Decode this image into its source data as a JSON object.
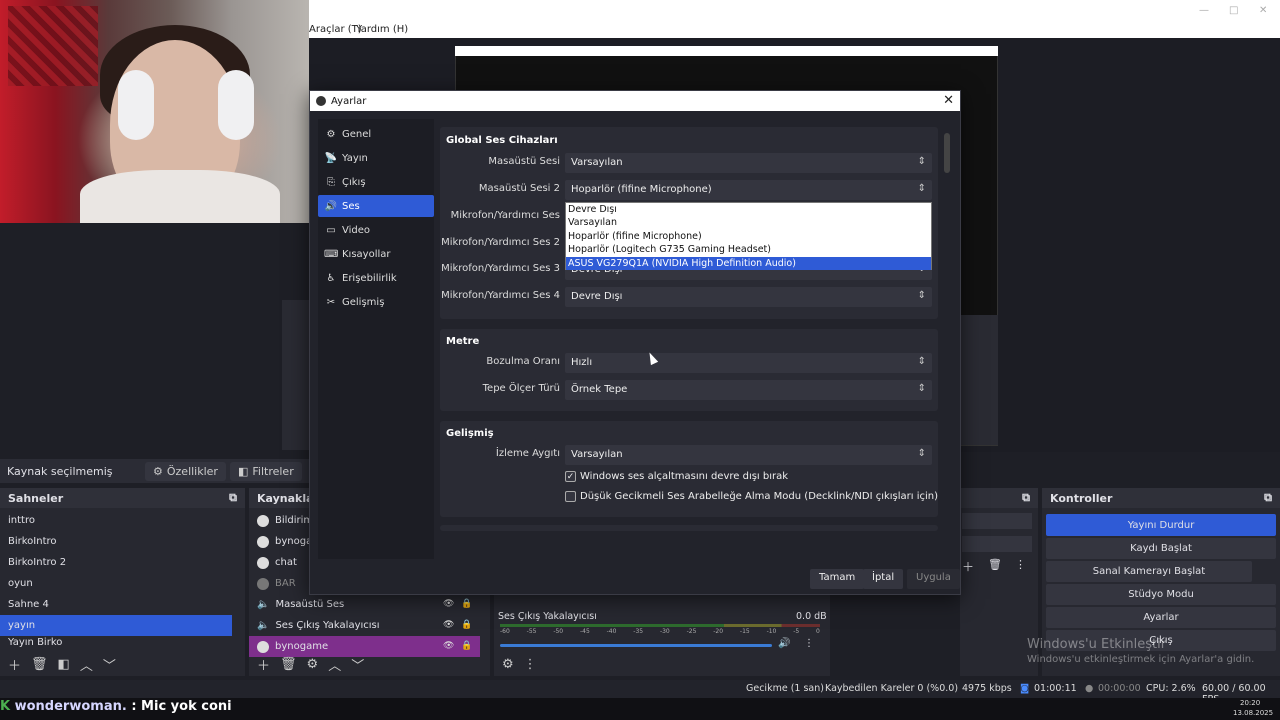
{
  "menu": {
    "tools": "Araçlar (T)",
    "help": "Yardım (H)"
  },
  "dialog": {
    "title": "Ayarlar",
    "sidebar": [
      "Genel",
      "Yayın",
      "Çıkış",
      "Ses",
      "Video",
      "Kısayollar",
      "Erişebilirlik",
      "Gelişmiş"
    ],
    "global_title": "Global Ses Cihazları",
    "desktop1_label": "Masaüstü Sesi",
    "desktop1_value": "Varsayılan",
    "desktop2_label": "Masaüstü Sesi 2",
    "desktop2_value": "Hoparlör (fifine Microphone)",
    "mic1_label": "Mikrofon/Yardımcı Ses",
    "mic2_label": "Mikrofon/Yardımcı Ses 2",
    "mic3_label": "Mikrofon/Yardımcı Ses 3",
    "mic3_value": "Devre Dışı",
    "mic4_label": "Mikrofon/Yardımcı Ses 4",
    "mic4_value": "Devre Dışı",
    "dropdown": [
      "Devre Dışı",
      "Varsayılan",
      "Hoparlör (fifine Microphone)",
      "Hoparlör (Logitech G735 Gaming Headset)",
      "ASUS VG279Q1A (NVIDIA High Definition Audio)"
    ],
    "meter_title": "Metre",
    "decay_label": "Bozulma Oranı",
    "decay_value": "Hızlı",
    "peak_label": "Tepe Ölçer Türü",
    "peak_value": "Örnek Tepe",
    "adv_title": "Gelişmiş",
    "monitor_label": "İzleme Aygıtı",
    "monitor_value": "Varsayılan",
    "check1": "Windows ses alçaltmasını devre dışı bırak",
    "check2": "Düşük Gecikmeli Ses Arabelleğe Alma Modu (Decklink/NDI çıkışları için)",
    "ok": "Tamam",
    "cancel": "İptal",
    "apply": "Uygula"
  },
  "source_bar": {
    "none": "Kaynak seçilmemiş",
    "props": "Özellikler",
    "filters": "Filtreler"
  },
  "scenes": {
    "title": "Sahneler",
    "items": [
      "inttro",
      "BirkoIntro",
      "BirkoIntro 2",
      "oyun",
      "Sahne 4",
      "yayın",
      "Yayın Birko"
    ]
  },
  "sources": {
    "title": "Kaynaklar",
    "items": [
      "Bildirim",
      "bynogan",
      "chat",
      "BAR",
      "Masaüstü Ses",
      "Ses Çıkış Yakalayıcısı",
      "bynogame"
    ]
  },
  "mixer": {
    "name": "Ses Çıkış Yakalayıcısı",
    "db": "0.0 dB",
    "ticks": [
      "-60",
      "-55",
      "-50",
      "-45",
      "-40",
      "-35",
      "-30",
      "-25",
      "-20",
      "-15",
      "-10",
      "-5",
      "0"
    ]
  },
  "controls": {
    "title": "Kontroller",
    "items": [
      "Yayını Durdur",
      "Kaydı Başlat",
      "Sanal Kamerayı Başlat",
      "Stüdyo Modu",
      "Ayarlar",
      "Çıkış"
    ]
  },
  "status": {
    "delay": "Gecikme (1 san)",
    "dropped": "Kaybedilen Kareler 0 (%0.0)",
    "kbps": "4975 kbps",
    "stream_time": "01:00:11",
    "rec_time": "00:00:00",
    "cpu": "CPU: 2.6%",
    "fps": "60.00 / 60.00 FPS"
  },
  "watermark": {
    "line1": "Windows'u Etkinleştir",
    "line2": "Windows'u etkinleştirmek için Ayarlar'a gidin."
  },
  "chat": {
    "user": "wonderwoman.",
    "message": ": Mic yok coni"
  },
  "clock": {
    "time": "20:20",
    "date": "13.08.2025"
  }
}
